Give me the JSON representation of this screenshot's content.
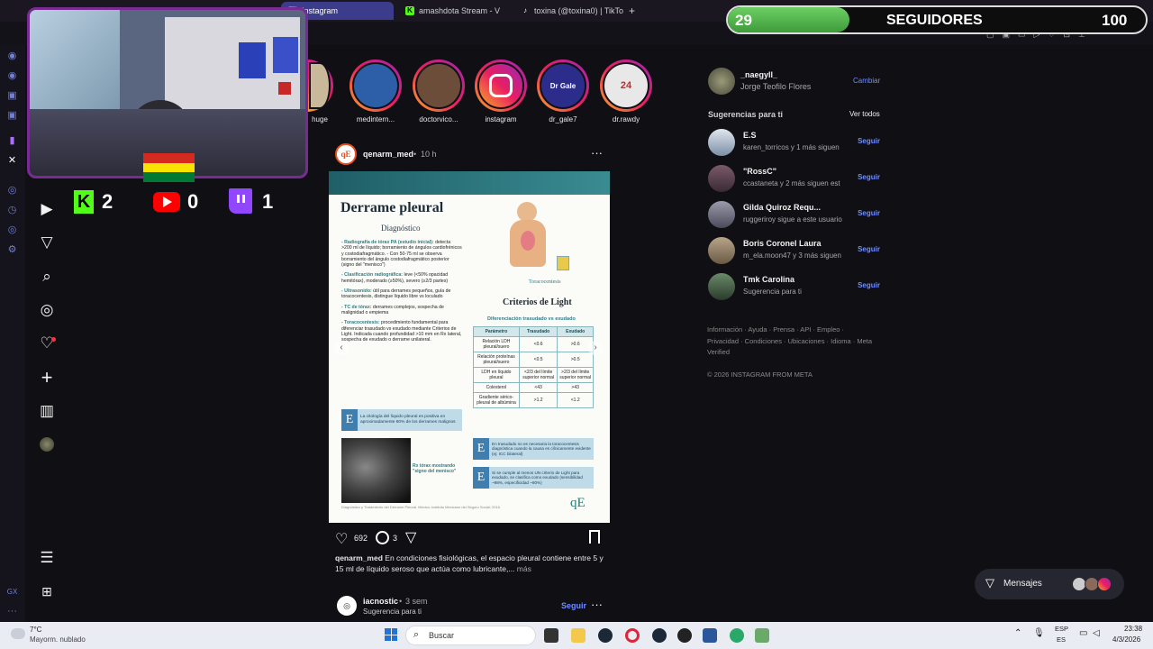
{
  "browser": {
    "tabs": [
      {
        "label": "Instagram"
      },
      {
        "label": "amashdota Stream - V"
      },
      {
        "label": "toxina (@toxina0) | TikTok"
      }
    ],
    "new_tab": "+"
  },
  "stream_overlay": {
    "followers": {
      "current": "29",
      "label": "SEGUIDORES",
      "goal": "100",
      "progress": 0.29
    },
    "counters": [
      {
        "platform": "kick",
        "value": "2"
      },
      {
        "platform": "youtube",
        "value": "0"
      },
      {
        "platform": "twitch",
        "value": "1"
      }
    ]
  },
  "stories": [
    {
      "name": "huge"
    },
    {
      "name": "medintern..."
    },
    {
      "name": "doctorvico..."
    },
    {
      "name": "instagram"
    },
    {
      "name": "dr_gale7",
      "badge": "Dr Gale"
    },
    {
      "name": "dr.rawdy",
      "badge": "24"
    }
  ],
  "post": {
    "author": "qenarm_med",
    "avatar_text": "qE",
    "time": "10 h",
    "likes": "692",
    "comments": "3",
    "caption_author": "qenarm_med",
    "caption": "En condiciones fisiológicas, el espacio pleural contiene entre 5 y 15 ml de líquido seroso que actúa como lubricante,...",
    "more": "más",
    "image": {
      "title": "Derrame pleural",
      "subtitle": "Diagnóstico",
      "bullets": [
        {
          "head": "- Radiografía de tórax PA (estudio inicial):",
          "body": "detecta >200 ml de líquido; borramiento de ángulos cardiofrénicos y costodiafragmático. - Con 50-75 ml se observa borramiento del ángulo costodiafragmático posterior (signo del \"menisco\")"
        },
        {
          "head": "- Clasificación radiográfica:",
          "body": "leve (<50% opacidad hemitórax), moderado (≥50%), severo (≥2/3 partes)"
        },
        {
          "head": "- Ultrasonido:",
          "body": "útil para derrames pequeños, guía de toracocentesis, distingue líquido libre vs loculado"
        },
        {
          "head": "- TC de tórax:",
          "body": "derrames complejos, sospecha de malignidad o empiema"
        },
        {
          "head": "- Toracocentesis:",
          "body": "procedimiento fundamental para diferenciar trasudado vs exudado mediante Criterios de Light. Indicada cuando profundidad >10 mm en Rx lateral, sospecha de exudado o derrame unilateral."
        }
      ],
      "thoracentesis_label": "Toracocentesis",
      "criteria_title": "Criterios de Light",
      "table_caption": "Diferenciación trasudado vs exudado",
      "table_headers": [
        "Parámetro",
        "Trasudado",
        "Exudado"
      ],
      "table_rows": [
        [
          "Relación LDH pleural/suero",
          "<0.6",
          ">0.6"
        ],
        [
          "Relación proteínas pleural/suero",
          "<0.5",
          ">0.5"
        ],
        [
          "LDH en líquido pleural",
          "<2/3 del límite superior normal",
          ">2/3 del límite superior normal"
        ],
        [
          "Colesterol",
          "<43",
          ">43"
        ],
        [
          "Gradiente sérico-pleural de albúmina",
          ">1.2",
          "<1.2"
        ]
      ],
      "evidence_boxes": [
        "La citología del líquido pleural es positiva en aproximadamente 60% de los derrames malignos",
        "En trasudado no es necesaria la toracocentesis diagnóstica cuando la causa es clínicamente evidente (ej: ICC bilateral)",
        "Si se cumple al menos UN criterio de Light para exudado, se clasifica como exudado (sensibilidad ~98%, especificidad ~80%)"
      ],
      "xray_caption": "Rx tórax mostrando \"signo del menisco\"",
      "footnote": "Diagnóstico y Tratamiento del Derrame Pleural. México: Instituto Mexicano del Seguro Social; 2016.",
      "logo": "qE"
    }
  },
  "next_post": {
    "author": "iacnostic",
    "time": "3 sem",
    "sub": "Sugerencia para ti",
    "follow": "Seguir"
  },
  "profile": {
    "username": "_naegyll_",
    "full_name": "Jorge Teofilo Flores",
    "switch": "Cambiar"
  },
  "suggestions": {
    "title": "Sugerencias para ti",
    "see_all": "Ver todos",
    "follow_label": "Seguir",
    "items": [
      {
        "name": "E.S",
        "sub": "karen_torricos y 1 más siguen"
      },
      {
        "name": "\"RossC\"",
        "sub": "ccastaneta y 2 más siguen est"
      },
      {
        "name": "Gilda Quiroz Requ...",
        "sub": "ruggeriroy sigue a este usuario"
      },
      {
        "name": "Boris Coronel Laura",
        "sub": "m_ela.moon47 y 3 más siguen"
      },
      {
        "name": "Tmk Carolina",
        "sub": "Sugerencia para ti"
      }
    ]
  },
  "footer": {
    "links": "Información · Ayuda · Prensa · API · Empleo · Privacidad · Condiciones · Ubicaciones · Idioma · Meta Verified",
    "copyright": "© 2026 INSTAGRAM FROM META"
  },
  "messages": {
    "label": "Mensajes"
  },
  "taskbar": {
    "weather_temp": "7°C",
    "weather_desc": "Mayorm. nublado",
    "search": "Buscar",
    "lang1": "ESP",
    "lang2": "ES",
    "time": "23:38",
    "date": "4/3/2026"
  },
  "colors": {
    "accent": "#6f8cff",
    "overlay_border": "#7a2a94",
    "progress": "#4caf50"
  }
}
